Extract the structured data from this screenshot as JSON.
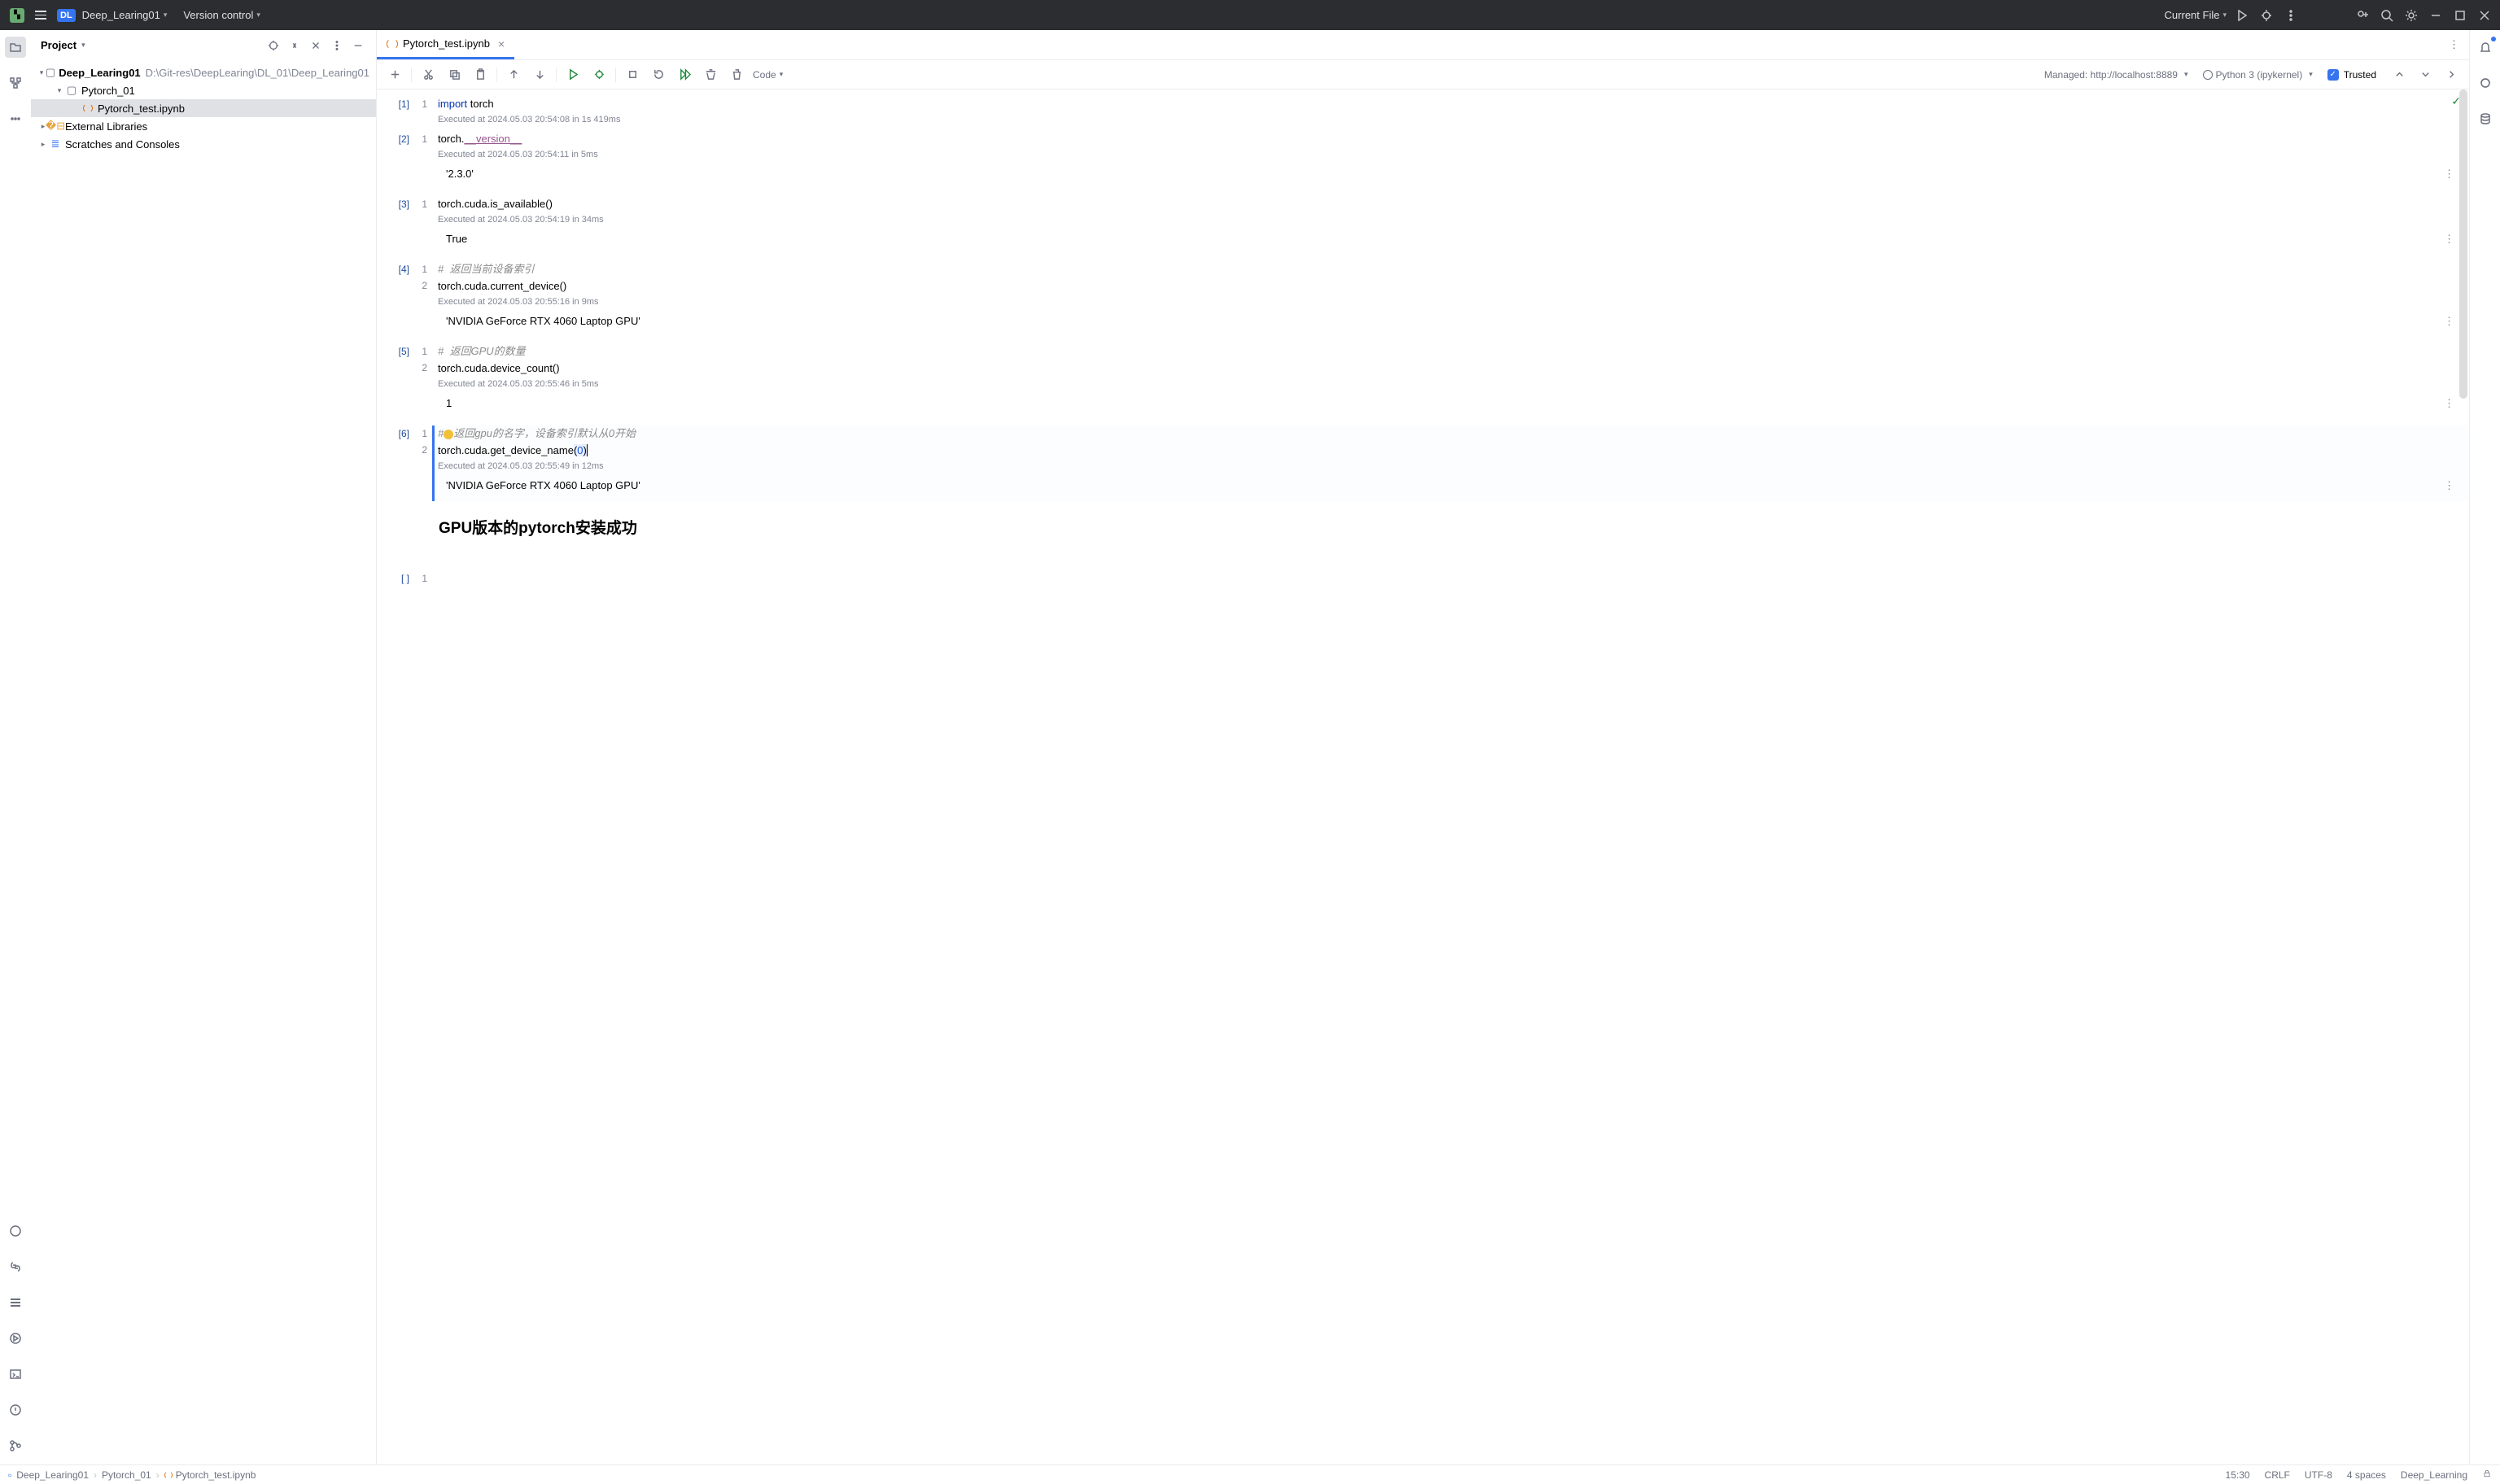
{
  "titlebar": {
    "project": "Deep_Learing01",
    "vcs": "Version control",
    "run_config": "Current File"
  },
  "sidebar": {
    "title": "Project",
    "root": {
      "name": "Deep_Learing01",
      "path": "D:\\Git-res\\DeepLearing\\DL_01\\Deep_Learing01"
    },
    "folder1": "Pytorch_01",
    "file1": "Pytorch_test.ipynb",
    "ext_libs": "External Libraries",
    "scratches": "Scratches and Consoles"
  },
  "tab": {
    "name": "Pytorch_test.ipynb"
  },
  "nb_toolbar": {
    "cell_type": "Code",
    "managed": "Managed: http://localhost:8889",
    "kernel": "Python 3 (ipykernel)",
    "trusted": "Trusted"
  },
  "cells": {
    "c1": {
      "idx": "[1]",
      "ln": "1",
      "code_kw": "import",
      "code_rest": " torch",
      "exec": "Executed at 2024.05.03 20:54:08 in 1s 419ms"
    },
    "c2": {
      "idx": "[2]",
      "ln": "1",
      "code_pre": "torch.",
      "code_dunder": "__version__",
      "exec": "Executed at 2024.05.03 20:54:11 in 5ms",
      "out": "'2.3.0'"
    },
    "c3": {
      "idx": "[3]",
      "ln": "1",
      "code": "torch.cuda.is_available()",
      "exec": "Executed at 2024.05.03 20:54:19 in 34ms",
      "out": "True"
    },
    "c4": {
      "idx": "[4]",
      "ln1": "1",
      "ln2": "2",
      "comment": "#  返回当前设备索引",
      "code": "torch.cuda.current_device()",
      "exec": "Executed at 2024.05.03 20:55:16 in 9ms",
      "out": "'NVIDIA GeForce RTX 4060 Laptop GPU'"
    },
    "c5": {
      "idx": "[5]",
      "ln1": "1",
      "ln2": "2",
      "comment": "#  返回GPU的数量",
      "code": "torch.cuda.device_count()",
      "exec": "Executed at 2024.05.03 20:55:46 in 5ms",
      "out": "1"
    },
    "c6": {
      "idx": "[6]",
      "ln1": "1",
      "ln2": "2",
      "comment_pre": "#",
      "comment_post": "返回gpu的名字，设备索引默认从0开始",
      "code_pre": "torch.cuda.get_device_name",
      "arg": "0",
      "exec": "Executed at 2024.05.03 20:55:49 in 12ms",
      "out": "'NVIDIA GeForce RTX 4060 Laptop GPU'"
    },
    "c7": {
      "idx": "[ ]",
      "ln": "1"
    }
  },
  "markdown": {
    "heading": "GPU版本的pytorch安装成功"
  },
  "breadcrumbs": {
    "b1": "Deep_Learing01",
    "b2": "Pytorch_01",
    "b3": "Pytorch_test.ipynb"
  },
  "status": {
    "time": "15:30",
    "le": "CRLF",
    "enc": "UTF-8",
    "indent": "4 spaces",
    "interp": "Deep_Learning"
  }
}
